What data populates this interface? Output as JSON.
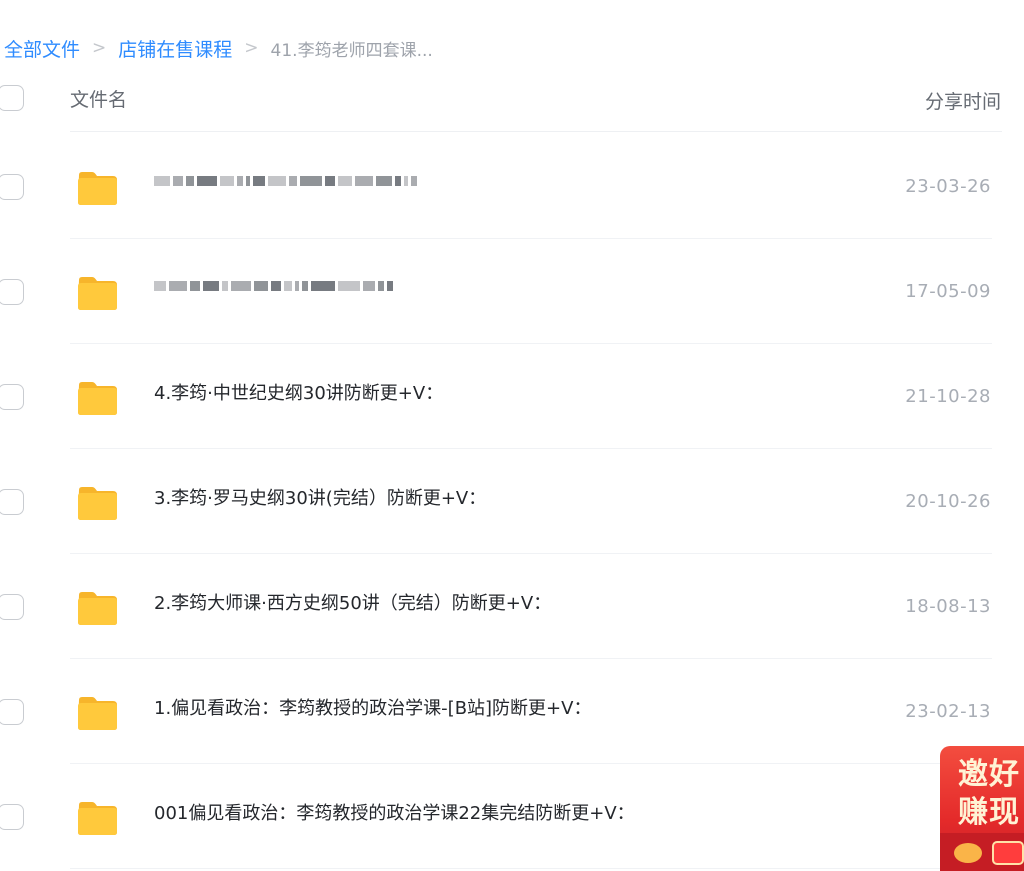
{
  "breadcrumb": {
    "items": [
      "全部文件",
      "店铺在售课程"
    ],
    "current": "41.李筠老师四套课..."
  },
  "header": {
    "name_label": "文件名",
    "time_label": "分享时间"
  },
  "files": [
    {
      "name": "",
      "blurred": true,
      "date": "23-03-26"
    },
    {
      "name": "",
      "blurred": true,
      "date": "17-05-09"
    },
    {
      "name": "4.李筠·中世纪史纲30讲防断更+V：",
      "blurred": false,
      "date": "21-10-28"
    },
    {
      "name": "3.李筠·罗马史纲30讲(完结）防断更+V：",
      "blurred": false,
      "date": "20-10-26"
    },
    {
      "name": "2.李筠大师课·西方史纲50讲（完结）防断更+V：",
      "blurred": false,
      "date": "18-08-13"
    },
    {
      "name": "1.偏见看政治：李筠教授的政治学课-[B站]防断更+V：",
      "blurred": false,
      "date": "23-02-13"
    },
    {
      "name": "001偏见看政治：李筠教授的政治学课22集完结防断更+V：",
      "blurred": false,
      "date": "23-0"
    }
  ],
  "promo": {
    "line1": "邀好",
    "line2": "赚现"
  },
  "colors": {
    "link": "#2f8cff",
    "folder": "#ffc93c",
    "promo": "#e42a2a"
  }
}
